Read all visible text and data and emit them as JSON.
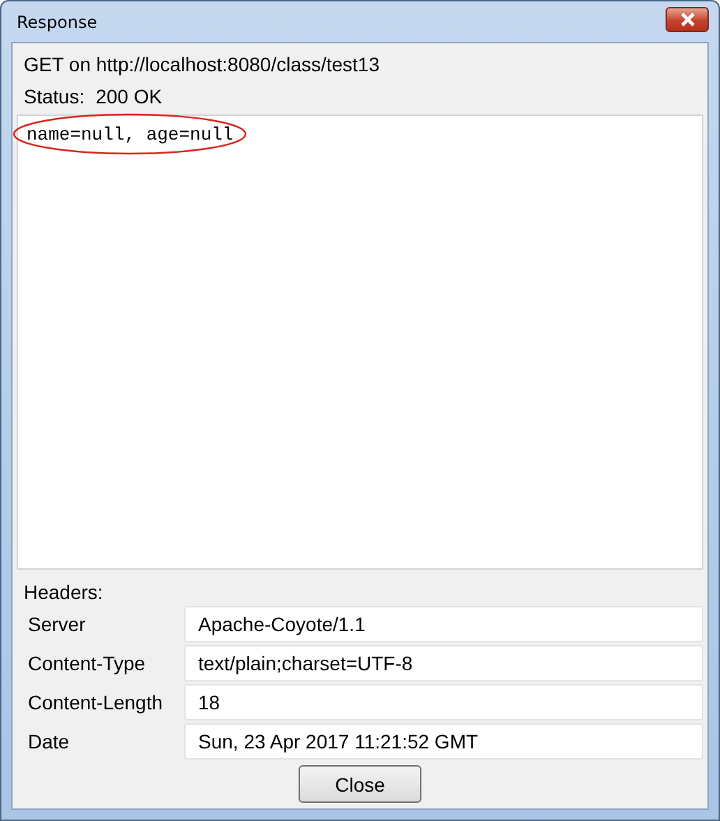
{
  "window": {
    "title": "Response"
  },
  "request_line": "GET on http://localhost:8080/class/test13",
  "status": {
    "label": "Status:",
    "value": "200 OK"
  },
  "body": "name=null, age=null",
  "headers_label": "Headers:",
  "headers": [
    {
      "name": "Server",
      "value": "Apache-Coyote/1.1"
    },
    {
      "name": "Content-Type",
      "value": "text/plain;charset=UTF-8"
    },
    {
      "name": "Content-Length",
      "value": "18"
    },
    {
      "name": "Date",
      "value": "Sun, 23 Apr 2017 11:21:52 GMT"
    }
  ],
  "buttons": [
    "Close"
  ]
}
